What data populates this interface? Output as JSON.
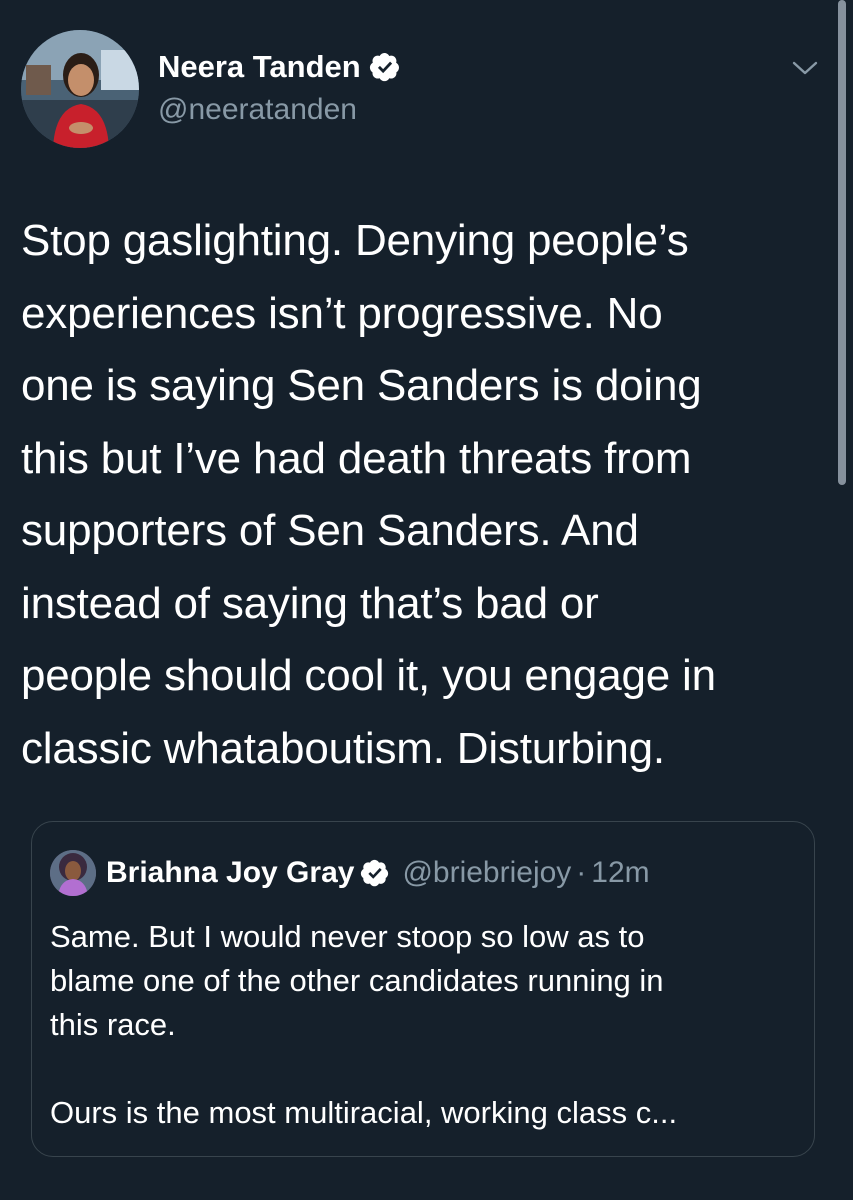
{
  "author": {
    "name": "Neera Tanden",
    "handle": "@neeratanden",
    "verified": true
  },
  "tweet": {
    "lines": [
      "Stop gaslighting. Denying people’s",
      "experiences isn’t progressive. No",
      "one is saying Sen Sanders is doing",
      "this but I’ve had death threats from",
      "supporters of Sen Sanders. And",
      "instead of saying that’s bad or",
      "people should cool it, you engage in",
      "classic whataboutism. Disturbing."
    ]
  },
  "quoted_tweet": {
    "name": "Briahna Joy Gray",
    "handle": "@briebriejoy",
    "separator": "·",
    "time": "12m",
    "verified": true,
    "lines": [
      "Same. But I would never stoop so low as to",
      "blame one of the other candidates running in",
      "this race.",
      "",
      "Ours is the most multiracial, working class c..."
    ]
  },
  "icons": {
    "verified": "verified-badge-icon",
    "menu": "chevron-down-icon"
  },
  "colors": {
    "background": "#15202b",
    "secondary_text": "#8899a6",
    "border": "#38444d"
  }
}
